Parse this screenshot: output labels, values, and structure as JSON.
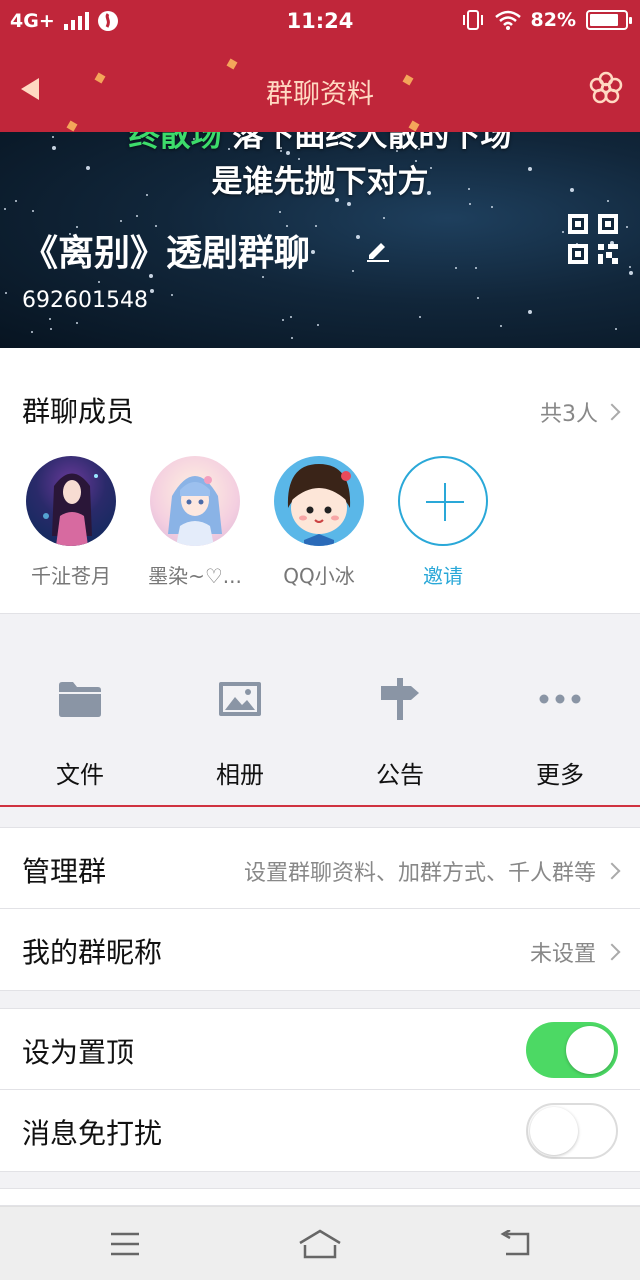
{
  "status_bar": {
    "network": "4G+",
    "time": "11:24",
    "battery": "82%",
    "battery_level": 0.82
  },
  "header": {
    "title": "群聊资料",
    "lyric_line1_highlight": "终散场",
    "lyric_line1_rest": " 落下曲终人散的下场",
    "lyric_line2": "是谁先抛下对方",
    "group_name": "《离别》透剧群聊",
    "group_id": "692601548"
  },
  "members": {
    "title": "群聊成员",
    "count": "共3人",
    "list": [
      {
        "name": "千沚苍月"
      },
      {
        "name": "墨染~♡..."
      },
      {
        "name": "QQ小冰"
      }
    ],
    "invite_label": "邀请"
  },
  "actions": [
    {
      "label": "文件",
      "icon": "folder-icon"
    },
    {
      "label": "相册",
      "icon": "image-icon"
    },
    {
      "label": "公告",
      "icon": "signpost-icon"
    },
    {
      "label": "更多",
      "icon": "more-icon"
    }
  ],
  "settings": {
    "manage": {
      "label": "管理群",
      "value": "设置群聊资料、加群方式、千人群等"
    },
    "nickname": {
      "label": "我的群昵称",
      "value": "未设置"
    },
    "pin": {
      "label": "设为置顶",
      "on": true
    },
    "dnd": {
      "label": "消息免打扰",
      "on": false
    }
  },
  "colors": {
    "brand_red": "#c0263a",
    "toggle_on": "#4cd964",
    "link_blue": "#2aa8d8"
  }
}
